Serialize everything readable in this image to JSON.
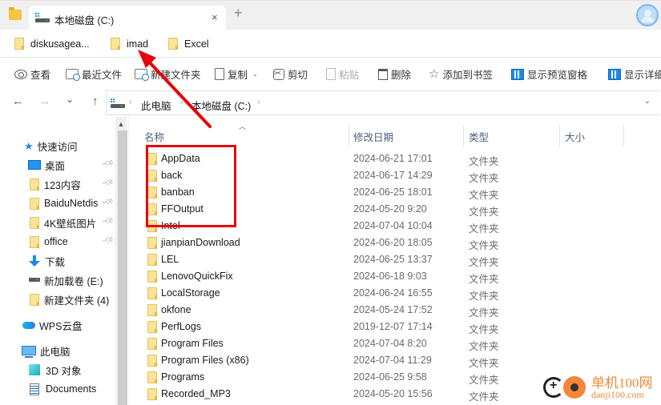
{
  "window": {
    "tab_title": "本地磁盘 (C:)",
    "close_glyph": "×",
    "add_glyph": "+"
  },
  "bookmarks": [
    {
      "label": "diskusagea..."
    },
    {
      "label": "imad"
    },
    {
      "label": "Excel"
    }
  ],
  "toolbar": {
    "view": "查看",
    "recent": "最近文件",
    "new_folder": "新建文件夹",
    "copy": "复制",
    "cut": "剪切",
    "paste": "粘贴",
    "delete": "删除",
    "add_bookmark": "添加到书签",
    "preview_pane": "显示预览窗格",
    "details_pane": "显示详细"
  },
  "nav": {
    "back": "←",
    "forward": "→",
    "recent": "⌄",
    "up": "↑",
    "breadcrumb": [
      "此电脑",
      "本地磁盘 (C:)"
    ],
    "separator": "›",
    "dropdown": "⌄"
  },
  "sidebar": {
    "quick_access": "快速访问",
    "items": [
      {
        "label": "桌面",
        "icon": "desktop-icon",
        "pinned": true
      },
      {
        "label": "123内容",
        "icon": "folder-icon",
        "pinned": true
      },
      {
        "label": "BaiduNetdis",
        "icon": "folder-icon",
        "pinned": true
      },
      {
        "label": "4K壁纸图片",
        "icon": "folder-icon",
        "pinned": true
      },
      {
        "label": "office",
        "icon": "folder-icon",
        "pinned": true
      },
      {
        "label": "下载",
        "icon": "download-icon",
        "pinned": false
      },
      {
        "label": "新加载卷 (E:)",
        "icon": "drive-icon",
        "pinned": false
      },
      {
        "label": "新建文件夹 (4)",
        "icon": "folder-icon",
        "pinned": false
      }
    ],
    "wps": "WPS云盘",
    "this_pc": "此电脑",
    "pc_items": [
      {
        "label": "3D 对象",
        "icon": "3d-objects-icon"
      },
      {
        "label": "Documents",
        "icon": "documents-icon"
      }
    ]
  },
  "columns": {
    "name": "名称",
    "modified": "修改日期",
    "type": "类型",
    "size": "大小"
  },
  "files": [
    {
      "name": "AppData",
      "modified": "2024-06-21 17:01",
      "type": "文件夹"
    },
    {
      "name": "back",
      "modified": "2024-06-17 14:29",
      "type": "文件夹"
    },
    {
      "name": "banban",
      "modified": "2024-06-25 18:01",
      "type": "文件夹"
    },
    {
      "name": "FFOutput",
      "modified": "2024-05-20 9:20",
      "type": "文件夹"
    },
    {
      "name": "Intel",
      "modified": "2024-07-04 10:04",
      "type": "文件夹"
    },
    {
      "name": "jianpianDownload",
      "modified": "2024-06-20 18:05",
      "type": "文件夹"
    },
    {
      "name": "LEL",
      "modified": "2024-06-25 13:37",
      "type": "文件夹"
    },
    {
      "name": "LenovoQuickFix",
      "modified": "2024-06-18 9:03",
      "type": "文件夹"
    },
    {
      "name": "LocalStorage",
      "modified": "2024-06-24 16:55",
      "type": "文件夹"
    },
    {
      "name": "okfone",
      "modified": "2024-05-24 17:52",
      "type": "文件夹"
    },
    {
      "name": "PerfLogs",
      "modified": "2019-12-07 17:14",
      "type": "文件夹"
    },
    {
      "name": "Program Files",
      "modified": "2024-07-04 8:20",
      "type": "文件夹"
    },
    {
      "name": "Program Files (x86)",
      "modified": "2024-07-04 11:29",
      "type": "文件夹"
    },
    {
      "name": "Programs",
      "modified": "2024-06-25 9:58",
      "type": "文件夹"
    },
    {
      "name": "Recorded_MP3",
      "modified": "2024-05-20 15:56",
      "type": "文件夹"
    }
  ],
  "annotation": {
    "highlight_color": "#e8000b"
  },
  "watermark": {
    "title": "单机100网",
    "url": "danji100.com"
  }
}
